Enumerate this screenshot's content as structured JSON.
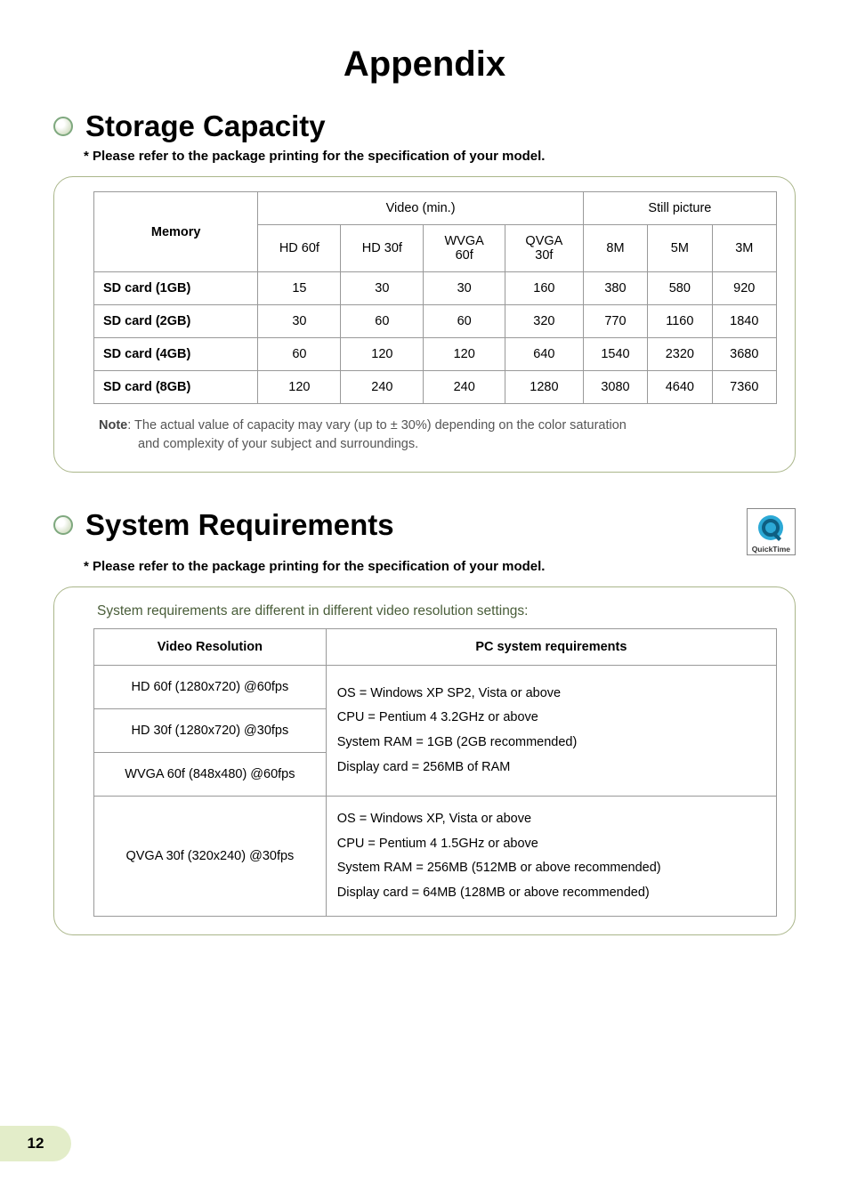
{
  "title": "Appendix",
  "section1": {
    "heading": "Storage Capacity",
    "subnote": "* Please refer to the package printing for the specification of your model.",
    "cols": {
      "memory": "Memory",
      "video_group": "Video (min.)",
      "still_group": "Still picture",
      "hd60": "HD 60f",
      "hd30": "HD 30f",
      "wvga": "WVGA\n60f",
      "qvga": "QVGA\n30f",
      "m8": "8M",
      "m5": "5M",
      "m3": "3M"
    },
    "rows": [
      {
        "label": "SD card (1GB)",
        "hd60": "15",
        "hd30": "30",
        "wvga": "30",
        "qvga": "160",
        "m8": "380",
        "m5": "580",
        "m3": "920"
      },
      {
        "label": "SD card (2GB)",
        "hd60": "30",
        "hd30": "60",
        "wvga": "60",
        "qvga": "320",
        "m8": "770",
        "m5": "1160",
        "m3": "1840"
      },
      {
        "label": "SD card (4GB)",
        "hd60": "60",
        "hd30": "120",
        "wvga": "120",
        "qvga": "640",
        "m8": "1540",
        "m5": "2320",
        "m3": "3680"
      },
      {
        "label": "SD card (8GB)",
        "hd60": "120",
        "hd30": "240",
        "wvga": "240",
        "qvga": "1280",
        "m8": "3080",
        "m5": "4640",
        "m3": "7360"
      }
    ],
    "note_label": "Note",
    "note_l1": ": The actual value of capacity may vary (up to ± 30%) depending on the color saturation",
    "note_l2": "and complexity of your subject and surroundings."
  },
  "section2": {
    "heading": "System Requirements",
    "qt_label": "QuickTime",
    "subnote": "* Please refer to the package printing for the specification of your model.",
    "intro": "System requirements are different in different video resolution settings:",
    "cols": {
      "vr": "Video Resolution",
      "req": "PC system requirements"
    },
    "vr1": "HD 60f (1280x720) @60fps",
    "vr2": "HD 30f (1280x720) @30fps",
    "vr3": "WVGA 60f (848x480) @60fps",
    "req1_l1": "OS = Windows XP SP2, Vista or above",
    "req1_l2": "CPU = Pentium 4   3.2GHz or above",
    "req1_l3": "System RAM = 1GB (2GB recommended)",
    "req1_l4": "Display card = 256MB of RAM",
    "vr4": "QVGA 30f (320x240) @30fps",
    "req2_l1": "OS = Windows XP, Vista or above",
    "req2_l2": "CPU = Pentium 4   1.5GHz or above",
    "req2_l3": "System RAM = 256MB (512MB or above recommended)",
    "req2_l4": "Display card = 64MB (128MB or above recommended)"
  },
  "pagenum": "12",
  "chart_data": [
    {
      "type": "table",
      "title": "Storage Capacity",
      "columns": [
        "Memory",
        "Video HD 60f (min)",
        "Video HD 30f (min)",
        "Video WVGA 60f (min)",
        "Video QVGA 30f (min)",
        "Still 8M",
        "Still 5M",
        "Still 3M"
      ],
      "rows": [
        [
          "SD card (1GB)",
          15,
          30,
          30,
          160,
          380,
          580,
          920
        ],
        [
          "SD card (2GB)",
          30,
          60,
          60,
          320,
          770,
          1160,
          1840
        ],
        [
          "SD card (4GB)",
          60,
          120,
          120,
          640,
          1540,
          2320,
          3680
        ],
        [
          "SD card (8GB)",
          120,
          240,
          240,
          1280,
          3080,
          4640,
          7360
        ]
      ]
    },
    {
      "type": "table",
      "title": "System Requirements",
      "columns": [
        "Video Resolution",
        "PC system requirements"
      ],
      "rows": [
        [
          "HD 60f (1280x720) @60fps",
          "OS = Windows XP SP2, Vista or above; CPU = Pentium 4 3.2GHz or above; System RAM = 1GB (2GB recommended); Display card = 256MB of RAM"
        ],
        [
          "HD 30f (1280x720) @30fps",
          "OS = Windows XP SP2, Vista or above; CPU = Pentium 4 3.2GHz or above; System RAM = 1GB (2GB recommended); Display card = 256MB of RAM"
        ],
        [
          "WVGA 60f (848x480) @60fps",
          "OS = Windows XP SP2, Vista or above; CPU = Pentium 4 3.2GHz or above; System RAM = 1GB (2GB recommended); Display card = 256MB of RAM"
        ],
        [
          "QVGA 30f (320x240) @30fps",
          "OS = Windows XP, Vista or above; CPU = Pentium 4 1.5GHz or above; System RAM = 256MB (512MB or above recommended); Display card = 64MB (128MB or above recommended)"
        ]
      ]
    }
  ]
}
